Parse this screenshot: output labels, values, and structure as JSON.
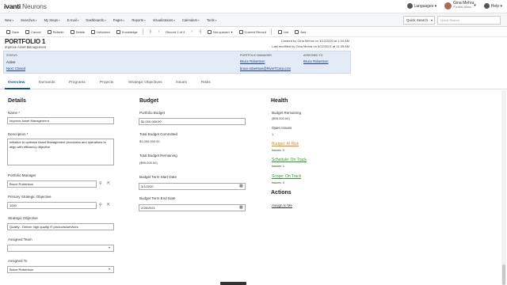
{
  "app": {
    "logo": "ivanti",
    "product": "Neurons"
  },
  "topright": {
    "languages": "Languages",
    "user": "Gina Mehra",
    "role": "Portfolio Mana...",
    "help": "Help"
  },
  "menu": [
    "New",
    "Searches",
    "My Steps",
    "E-mail",
    "Dashboards",
    "Pages",
    "Reports",
    "Visualizations",
    "Calendars",
    "Tools"
  ],
  "quick_search": "Quick Search",
  "search_placeholder": "Quick Search",
  "toolbar": {
    "save": "Save",
    "cancel": "Cancel",
    "refresh": "Refresh",
    "delete": "Delete",
    "unlocked": "Unlocked",
    "knowledge": "Knowledge",
    "record": "Record 1 of 4",
    "not_queued": "Not queued",
    "current_record": "Current Record",
    "list": "List",
    "and": "And"
  },
  "header": {
    "title": "PORTFOLIO 1",
    "subtitle": "Improve Asset Management",
    "created": "Created by Gina Mehra on 3/13/2020 at 1:34 AM",
    "modified": "Last modified by Gina Mehra on 5/22/2021 at 11:35 AM"
  },
  "infobar": {
    "status_label": "STATUS",
    "status_value": "Active",
    "next_label": "Next: Closed",
    "pm_label": "PORTFOLIO MANAGER",
    "pm_name": "Bruce Robertson",
    "pm_email": "bruce.robertson@RiverTCorp.com",
    "assigned_label": "ASSIGNED TO",
    "assigned_name": "Bruce Robertson"
  },
  "tabs": [
    "Overview",
    "Demands",
    "Programs",
    "Projects",
    "Strategic Objectives",
    "Issues",
    "Risks"
  ],
  "details": {
    "heading": "Details",
    "name_label": "Name *",
    "name_value": "Improve Asset Management",
    "desc_label": "Description *",
    "desc_value": "Initiative to optimize Asset Management processes and operations to align with efficiency objective",
    "pm_label": "Portfolio Manager",
    "pm_value": "Bruce Robertson",
    "pso_label": "Primary Strategic Objective",
    "pso_value": "1000",
    "so_label": "Strategic Objective",
    "so_value": "Quality - Deliver high quality IT products/services",
    "team_label": "Assigned Team",
    "team_value": "",
    "to_label": "Assigned To",
    "to_value": "Bruce Robertson"
  },
  "budget": {
    "heading": "Budget",
    "pb_label": "Portfolio Budget",
    "pb_value": "$1,000,000.00",
    "tbc_label": "Total Budget Committed",
    "tbc_value": "$1,000,000.00",
    "tbr_label": "Total Budget Remaining",
    "tbr_value": "($99,000.00)",
    "start_label": "Budget Term Start Date",
    "start_value": "3/1/2020",
    "end_label": "Budget Term End Date",
    "end_value": "2/28/2021"
  },
  "health": {
    "heading": "Health",
    "br_label": "Budget Remaining",
    "br_value": "($99,000.00)",
    "oi_label": "Open Issues",
    "oi_value": "1",
    "budget_link": "Budget: At Risk",
    "budget_issues": "Issues: 0",
    "schedule_link": "Schedule: On Track",
    "schedule_issues": "Issues: 1",
    "scope_link": "Scope: On Track",
    "scope_issues": "Issues: 0",
    "colors": {
      "at_risk": "#e08a1e",
      "on_track": "#2e9a2e"
    }
  },
  "actions": {
    "heading": "Actions",
    "assign": "Assign to Me"
  }
}
